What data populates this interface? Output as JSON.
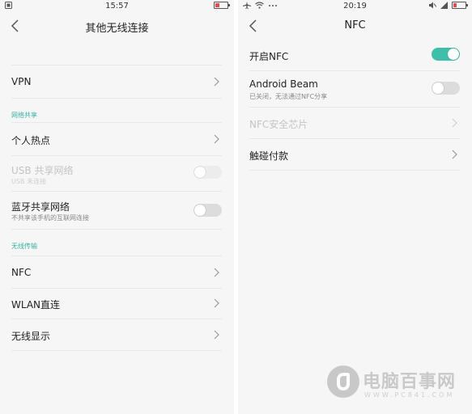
{
  "left_screen": {
    "status_time": "15:57",
    "title": "其他无线连接",
    "vpn": "VPN",
    "section_network_sharing": "网络共享",
    "hotspot": "个人热点",
    "usb_sharing": "USB 共享网络",
    "usb_sharing_sub": "USB 未连接",
    "bt_sharing": "蓝牙共享网络",
    "bt_sharing_sub": "不共享该手机的互联网连接",
    "section_wireless": "无线传输",
    "nfc": "NFC",
    "wlan_direct": "WLAN直连",
    "wireless_display": "无线显示",
    "usb_sharing_enabled": false,
    "bt_sharing_on": false
  },
  "right_screen": {
    "status_time": "20:19",
    "title": "NFC",
    "enable_nfc": "开启NFC",
    "enable_nfc_on": true,
    "android_beam": "Android Beam",
    "android_beam_sub": "已关闭，无法通过NFC分享",
    "android_beam_on": false,
    "nfc_secure_chip": "NFC安全芯片",
    "tap_pay": "触碰付款"
  },
  "watermark": {
    "text": "电脑百事网",
    "url": "WWW.PC841.COM"
  },
  "colors": {
    "accent": "#3dbfaa",
    "section": "#3ab3a0",
    "background": "#f6f6f7"
  },
  "icons": [
    "back-arrow-icon",
    "chevron-right-icon",
    "wifi-icon",
    "airplane-icon",
    "battery-icon",
    "mute-icon",
    "signal-icon"
  ]
}
